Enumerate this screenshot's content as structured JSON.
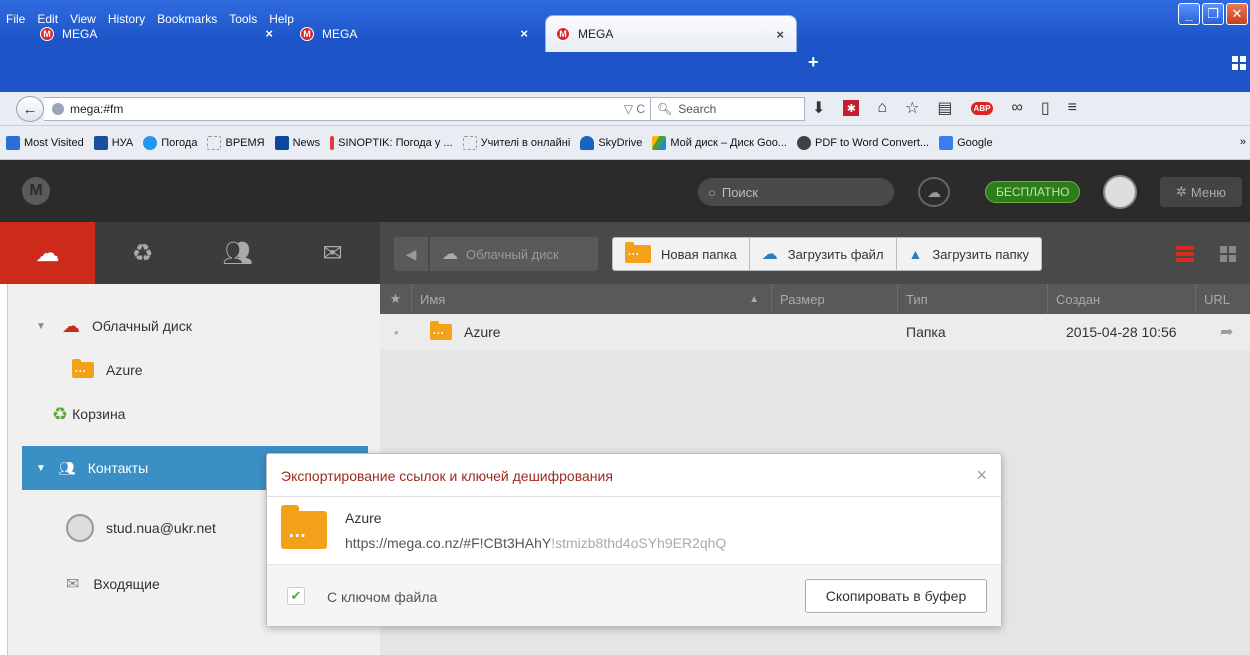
{
  "menu": [
    "File",
    "Edit",
    "View",
    "History",
    "Bookmarks",
    "Tools",
    "Help"
  ],
  "tabs": [
    {
      "title": "MEGA",
      "active": false
    },
    {
      "title": "MEGA",
      "active": false
    },
    {
      "title": "MEGA",
      "active": true
    }
  ],
  "tab_logo": "M",
  "tab_close": "×",
  "new_tab": "+",
  "address": {
    "url": "mega:#fm",
    "icons": "▽ C"
  },
  "search": {
    "placeholder": "Search"
  },
  "bookmarks": [
    {
      "label": "Most Visited",
      "color": "#2a6fd6"
    },
    {
      "label": "НУА",
      "color": "#1a4f9e"
    },
    {
      "label": "Погода",
      "color": "#2196f3"
    },
    {
      "label": "ВРЕМЯ",
      "color": "#cccccc"
    },
    {
      "label": "News",
      "color": "#0d47a1"
    },
    {
      "label": "SINOPTIK: Погода у ...",
      "color": "#e53935"
    },
    {
      "label": "Учителі в онлайні",
      "color": "#cccccc"
    },
    {
      "label": "SkyDrive",
      "color": "#1565c0"
    },
    {
      "label": "Мой диск – Диск Goo...",
      "color": "#ffb300"
    },
    {
      "label": "PDF to Word Convert...",
      "color": "#424242"
    },
    {
      "label": "Google",
      "color": "#3b7ded"
    }
  ],
  "bookmarks_more": "»",
  "mega_header": {
    "search_placeholder": "Поиск",
    "free_badge": "БЕСПЛАТНО",
    "menu_label": "Меню"
  },
  "breadcrumb": {
    "cloud_drive": "Облачный диск"
  },
  "toolbar": {
    "new_folder": "Новая папка",
    "upload_file": "Загрузить файл",
    "upload_folder": "Загрузить папку"
  },
  "tree": {
    "cloud_drive": "Облачный диск",
    "azure": "Azure",
    "trash": "Корзина",
    "contacts": "Контакты",
    "contact_email": "stud.nua@ukr.net",
    "inbox": "Входящие"
  },
  "table": {
    "headers": {
      "name": "Имя",
      "size": "Размер",
      "type": "Тип",
      "created": "Создан",
      "url": "URL"
    },
    "rows": [
      {
        "name": "Azure",
        "size": "",
        "type": "Папка",
        "created": "2015-04-28 10:56"
      }
    ]
  },
  "dialog": {
    "title": "Экспортирование ссылок и ключей дешифрования",
    "close": "×",
    "item_name": "Azure",
    "link_base": "https://mega.co.nz/#F!CBt3HAhY",
    "link_key": "!stmizb8thd4oSYh9ER2qhQ",
    "checkbox_label": "С ключом файла",
    "checked": true,
    "copy_button": "Скопировать в буфер"
  }
}
